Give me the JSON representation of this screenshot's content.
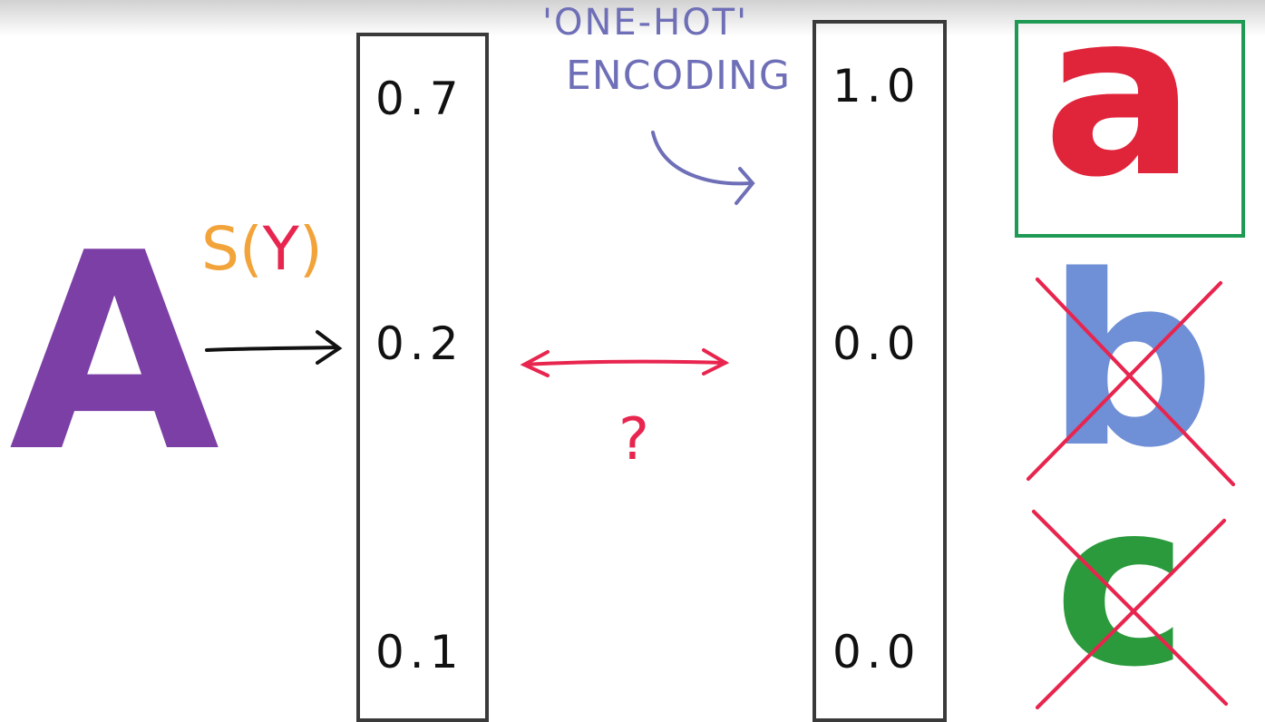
{
  "input_letter": "A",
  "function_label": "S(Y)",
  "one_hot_label": [
    "'ONE-HOT'",
    "ENCODING"
  ],
  "question_mark": "?",
  "softmax_column": [
    "0.7",
    "0.2",
    "0.1"
  ],
  "one_hot_column": [
    "1.0",
    "0.0",
    "0.0"
  ],
  "targets": [
    {
      "letter": "a",
      "color": "#e0243a",
      "selected": true
    },
    {
      "letter": "b",
      "color": "#6f8fd6",
      "selected": false
    },
    {
      "letter": "c",
      "color": "#2a9a3c",
      "selected": false
    }
  ],
  "colors": {
    "purple": "#7b3fa6",
    "orange": "#f2a33a",
    "pink": "#e8254e",
    "blue_ink": "#6f6fb8",
    "green_box": "#1f9a55",
    "cross": "#e8254e"
  }
}
